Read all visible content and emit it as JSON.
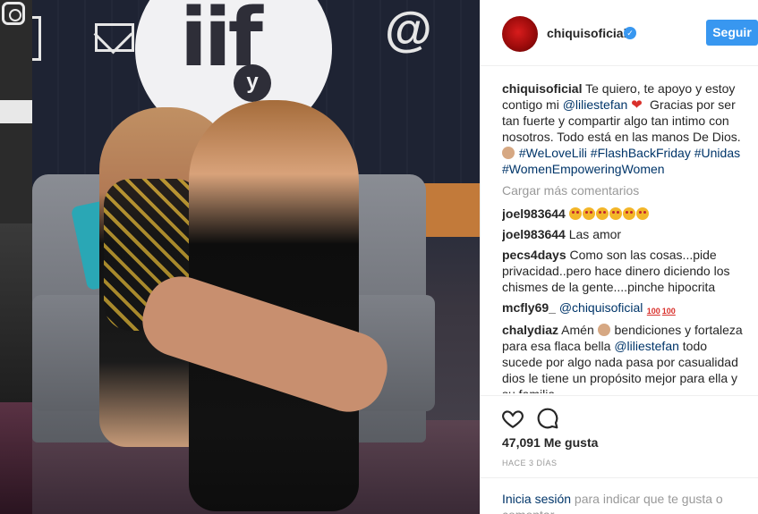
{
  "post": {
    "username": "chiquisoficial",
    "follow_label": "Seguir",
    "verified_glyph": "✓",
    "caption": {
      "username": "chiquisoficial",
      "text1": "Te quiero, te apoyo y estoy contigo mi ",
      "mention": "@liliestefan",
      "text2": " Gracias por ser tan fuerte y compartir algo tan intimo con nosotros. Todo está en las manos De Dios. ",
      "tags": [
        "#WeLoveLili",
        "#FlashBackFriday",
        "#Unidas",
        "#WomenEmpoweringWomen"
      ]
    },
    "load_more": "Cargar más comentarios",
    "comments": [
      {
        "user": "joel983644",
        "text": ""
      },
      {
        "user": "joel983644",
        "text": "Las amor"
      },
      {
        "user": "pecs4days",
        "text": "Como son las cosas...pide privacidad..pero hace dinero diciendo los chismes de la gente....pinche hipocrita"
      },
      {
        "user": "mcfly69_",
        "mention": "@chiquisoficial",
        "text": ""
      },
      {
        "user": "chalydiaz",
        "text1": "Amén ",
        "text2": " bendiciones y fortaleza para esa flaca bella ",
        "mention": "@liliestefan",
        "text3": " todo sucede por algo nada pasa por casualidad dios le tiene un propósito mejor para ella y su familia"
      }
    ],
    "likes": "47,091 Me gusta",
    "time": "HACE 3 DÍAS",
    "login_link": "Inicia sesión",
    "login_rest": " para indicar que te gusta o comentar."
  },
  "photo": {
    "logo_text": "iif",
    "logo_small": "y",
    "at_symbol": "@",
    "emoji_hundred": "100"
  },
  "colors": {
    "accent": "#3897f0",
    "link": "#003569",
    "muted": "#999999"
  },
  "icons": {
    "like": "heart-outline-icon",
    "comment": "speech-bubble-icon",
    "verified": "verified-badge-icon"
  }
}
